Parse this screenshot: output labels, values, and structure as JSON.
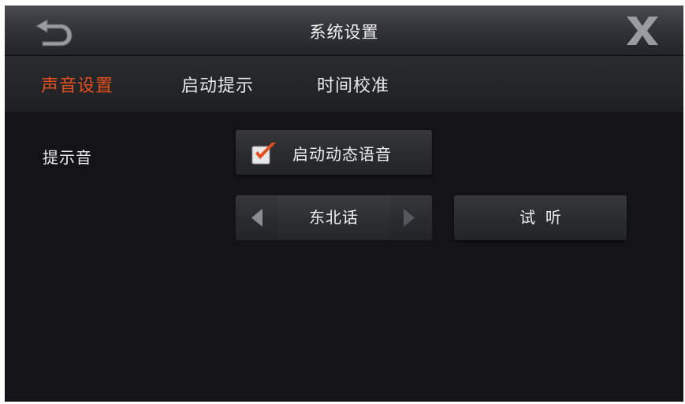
{
  "window": {
    "title": "系统设置",
    "back_icon": "back-arrow-icon",
    "close_icon": "close-x-icon"
  },
  "tabs": [
    {
      "label": "声音设置",
      "active": true
    },
    {
      "label": "启动提示",
      "active": false
    },
    {
      "label": "时间校准",
      "active": false
    }
  ],
  "sound": {
    "prompt_label": "提示音",
    "dynamic_voice": {
      "label": "启动动态语音",
      "checked": true
    },
    "dialect": {
      "value": "东北话",
      "prev_icon": "triangle-left-icon",
      "next_icon": "triangle-right-icon"
    },
    "listen_label": "试  听"
  },
  "colors": {
    "accent": "#e3501c",
    "background": "#141418",
    "text": "#ececec"
  }
}
